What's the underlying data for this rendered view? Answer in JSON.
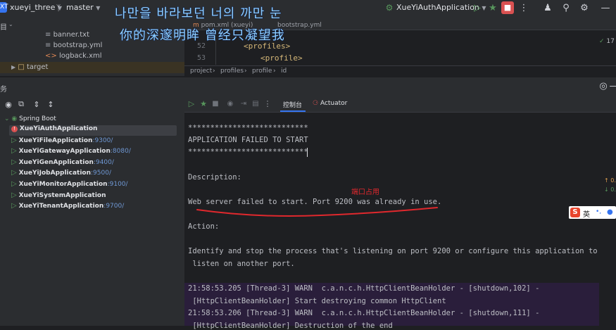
{
  "topbar": {
    "project_badge": "XT",
    "project_name": "xueyi_three",
    "branch": "master",
    "run_config": "XueYiAuthApplication"
  },
  "lyrics": {
    "line1": "나만을 바라보던 너의 까만 눈",
    "line2": "你的深邃明眸 曾经只凝望我"
  },
  "project_tree": {
    "partial_label": "目",
    "items": [
      {
        "label": "banner.txt"
      },
      {
        "label": "bootstrap.yml"
      },
      {
        "label": "logback.xml"
      },
      {
        "label": "target"
      }
    ]
  },
  "editor": {
    "tabs": [
      "pom.xml (xueyi)",
      "bootstrap.yml"
    ],
    "lines": [
      {
        "num": "52",
        "code": "<profiles>"
      },
      {
        "num": "53",
        "code": "<profile>"
      }
    ],
    "warnings": "17",
    "breadcrumbs": [
      "project",
      "profiles",
      "profile",
      "id"
    ]
  },
  "services": {
    "title_partial": "务",
    "root": "Spring Boot",
    "apps": [
      {
        "name": "XueYiAuthApplication",
        "port": "",
        "status": "error"
      },
      {
        "name": "XueYiFileApplication",
        "port": ":9300/",
        "status": "running"
      },
      {
        "name": "XueYiGatewayApplication",
        "port": ":8080/",
        "status": "running"
      },
      {
        "name": "XueYiGenApplication",
        "port": ":9400/",
        "status": "running"
      },
      {
        "name": "XueYiJobApplication",
        "port": ":9500/",
        "status": "running"
      },
      {
        "name": "XueYiMonitorApplication",
        "port": ":9100/",
        "status": "running"
      },
      {
        "name": "XueYiSystemApplication",
        "port": "",
        "status": "running"
      },
      {
        "name": "XueYiTenantApplication",
        "port": ":9700/",
        "status": "running"
      }
    ]
  },
  "console": {
    "tab_console": "控制台",
    "tab_actuator": "Actuator",
    "stars": "***************************",
    "failed": "APPLICATION FAILED TO START",
    "description_label": "Description:",
    "annotation": "端口占用",
    "error_line": "Web server failed to start. Port 9200 was already in use.",
    "action_label": "Action:",
    "action_line1": "Identify and stop the process that's listening on port 9200 or configure this application to",
    "action_line2": " listen on another port.",
    "log": [
      "21:58:53.205 [Thread-3] WARN  c.a.n.c.h.HttpClientBeanHolder - [shutdown,102] -",
      " [HttpClientBeanHolder] Start destroying common HttpClient",
      "21:58:53.206 [Thread-3] WARN  c.a.n.c.h.HttpClientBeanHolder - [shutdown,111] -",
      " [HttpClientBeanHolder] Destruction of the end"
    ],
    "side_up": "↑ 0.",
    "side_down": "↓ 0."
  },
  "ime": {
    "label": "英"
  },
  "colors": {
    "accent": "#3574f0",
    "error": "#d95151",
    "run": "#57965c",
    "annotation": "#e0282d"
  }
}
